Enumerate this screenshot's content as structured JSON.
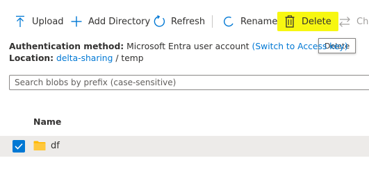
{
  "toolbar": {
    "upload_label": "Upload",
    "add_directory_label": "Add Directory",
    "refresh_label": "Refresh",
    "rename_label": "Rename",
    "delete_label": "Delete",
    "change_label_partial": "Cha"
  },
  "tooltip": {
    "text": "Delete"
  },
  "info": {
    "auth_label": "Authentication method:",
    "auth_value": "Microsoft Entra user account",
    "auth_link": "(Switch to Access key)",
    "location_label": "Location:",
    "location_link": "delta-sharing",
    "location_separator": "/",
    "location_folder": "temp"
  },
  "search": {
    "placeholder": "Search blobs by prefix (case-sensitive)"
  },
  "table": {
    "columns": [
      "Name"
    ],
    "rows": [
      {
        "name": "df",
        "selected": true,
        "type_icon": "folder-icon"
      }
    ]
  },
  "colors": {
    "accent": "#0078d4",
    "highlight": "#f7f711",
    "row_selected": "#edebe9",
    "folder": "#ffb900"
  }
}
